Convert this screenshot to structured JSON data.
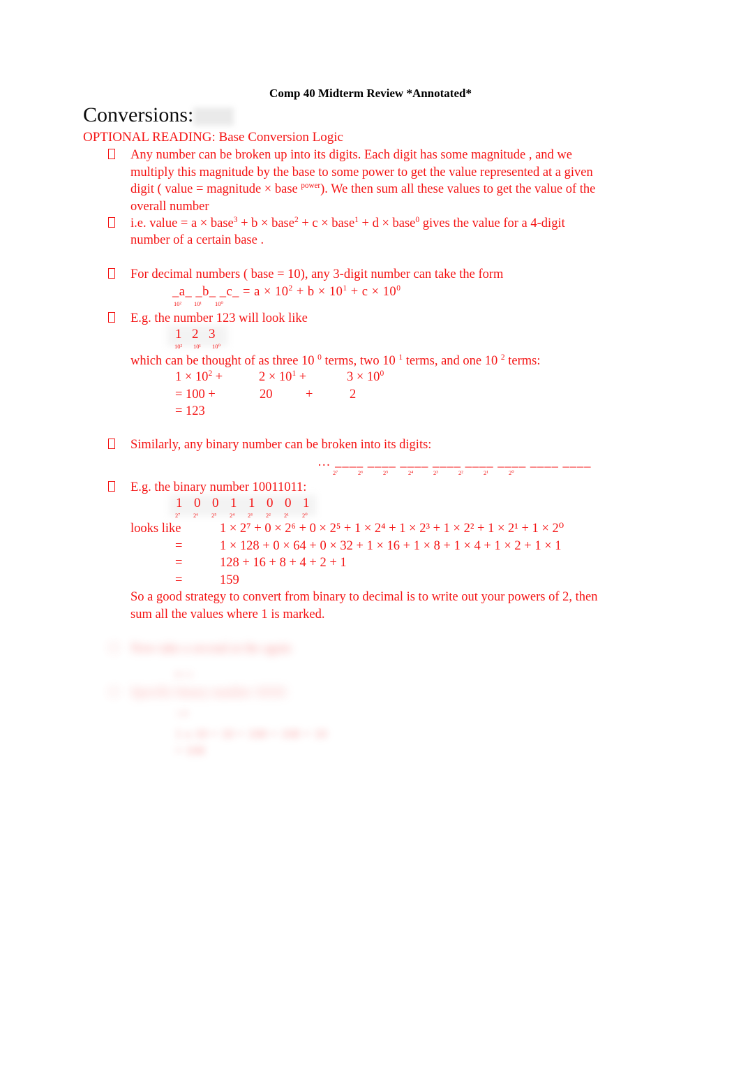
{
  "document": {
    "title": "Comp 40 Midterm Review *Annotated*",
    "section_heading": "Conversions:",
    "subheading": "OPTIONAL READING: Base Conversion Logic"
  },
  "bullets": {
    "b1_line1": "Any number can be broken up into its digits. Each digit has some      magnitude , and we",
    "b1_line2": "multiply this  magnitude  by the  base to some  power  to get the  value represented at a given",
    "b1_line3_a": "digit ( value = magnitude × base ",
    "b1_line3_sup": "power",
    "b1_line3_b": "). We then sum all these values to get the value of the",
    "b1_line4": "overall number",
    "b2_line1_a": "i.e.   value    =   a × base",
    "b2_sup3": "3",
    "b2_line1_b": "  +   b × base",
    "b2_sup2": "2",
    "b2_line1_c": "  +   c × base",
    "b2_sup1": "1",
    "b2_line1_d": "  +   d × base",
    "b2_sup0": "0",
    "b2_line1_e": " gives the value for a 4-digit",
    "b2_line2": "number of a certain   base .",
    "b3": "For decimal numbers (   base = 10), any 3-digit number can take the form",
    "b4": "E.g. the number 123 will look like",
    "b5": "Similarly, any binary number can be broken into its digits:",
    "b6": "E.g. the binary number 10011011:"
  },
  "decimal_form": {
    "placeholders": "_a_  _b_  _c_  =   a × 10",
    "exp2": "2",
    "mid1": "  +   b × 10",
    "exp1": "1",
    "mid2": "   +   c × 10",
    "exp0": "0",
    "under_labels": [
      "10²",
      "10¹",
      "10⁰"
    ]
  },
  "decimal_example": {
    "digits": [
      "1",
      "2",
      "3"
    ],
    "digit_labels": [
      "10²",
      "10¹",
      "10⁰"
    ],
    "explain_a": "which can be thought of as three 10 ",
    "explain_sup0": "0",
    "explain_b": " terms, two 10 ",
    "explain_sup1": "1",
    "explain_c": " terms, and one 10 ",
    "explain_sup2": "2",
    "explain_d": " terms:",
    "line1": {
      "t1": "1 × 10",
      "t1sup": "2",
      "t1plus": " +",
      "t2": "2 × 10",
      "t2sup": "1",
      "t2plus": " +",
      "t3": "3 × 10",
      "t3sup": "0"
    },
    "line2": {
      "eq": "=  100  +",
      "mid": "20",
      "plus": "+",
      "last": "2"
    },
    "line3": "= 123"
  },
  "binary_blanks": {
    "leader": "…",
    "blank": "____",
    "count": 8,
    "labels": [
      "2⁷",
      "2⁶",
      "2⁵",
      "2⁴",
      "2³",
      "2²",
      "2¹",
      "2⁰"
    ]
  },
  "binary_example": {
    "digits": [
      "1",
      "0",
      "0",
      "1",
      "1",
      "0",
      "0",
      "1"
    ],
    "digit_labels": [
      "2⁷",
      "2⁶",
      "2⁵",
      "2⁴",
      "2³",
      "2²",
      "2¹",
      "2⁰"
    ],
    "row1_label": "looks like",
    "row1": "1 × 2⁷ + 0 × 2⁶ + 0 × 2⁵ + 1 × 2⁴ + 1 × 2³ + 1 × 2² + 1 × 2¹ + 1 × 2⁰",
    "row2_label": "=",
    "row2": "1 × 128  + 0 × 64  + 0 × 32  + 1 × 16  + 1 × 8  + 1 × 4  + 1 × 2  + 1 × 1",
    "row3_label": "=",
    "row3": "128  + 16  + 8  + 4  + 2  + 1",
    "row4_label": "=",
    "row4": "159"
  },
  "closing": {
    "line1": "So a good strategy to convert from binary to decimal is to write out your powers of 2, then",
    "line2": "sum all the values where 1 is marked."
  },
  "redacted": {
    "note": "illegible blurred content",
    "line1": "Now take a second at the again",
    "line2": "0 1 1",
    "line3": "Specific binary number 10101",
    "line4": "1  0",
    "line5": "1 x 10  +   10  +  100              +  100  + 10",
    "line6": "= 100"
  },
  "colors": {
    "text_red": "#f41414",
    "heading_black": "#0d0d0d",
    "background": "#ffffff"
  }
}
